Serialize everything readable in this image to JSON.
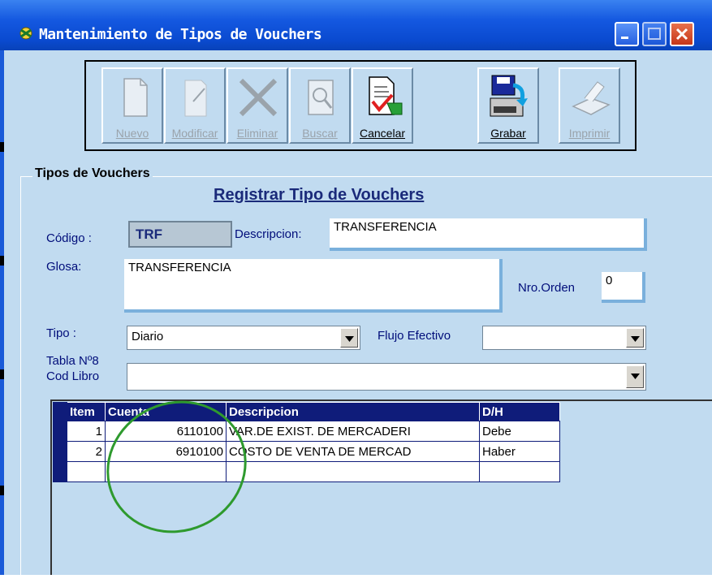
{
  "window": {
    "title": "Mantenimiento de Tipos de Vouchers"
  },
  "toolbar": {
    "buttons": [
      {
        "label": "Nuevo",
        "icon": "page-icon",
        "enabled": false
      },
      {
        "label": "Modificar",
        "icon": "edit-icon",
        "enabled": false
      },
      {
        "label": "Eliminar",
        "icon": "x-icon",
        "enabled": false
      },
      {
        "label": "Buscar",
        "icon": "search-doc-icon",
        "enabled": false
      },
      {
        "label": "Cancelar",
        "icon": "cancel-doc-icon",
        "enabled": true
      },
      {
        "label": "Grabar",
        "icon": "save-disk-icon",
        "enabled": true
      },
      {
        "label": "Imprimir",
        "icon": "printer-icon",
        "enabled": false
      }
    ]
  },
  "group": {
    "legend": "Tipos de Vouchers",
    "heading": "Registrar Tipo de Vouchers"
  },
  "form": {
    "codigo_label": "Código :",
    "codigo_value": "TRF",
    "descripcion_label": "Descripcion:",
    "descripcion_value": "TRANSFERENCIA",
    "glosa_label": "Glosa:",
    "glosa_value": "TRANSFERENCIA",
    "nro_orden_label": "Nro.Orden",
    "nro_orden_value": "0",
    "tipo_label": "Tipo :",
    "tipo_value": "Diario",
    "flujo_label": "Flujo Efectivo",
    "flujo_value": "",
    "tabla_label_1": "Tabla Nº8",
    "tabla_label_2": "Cod Libro",
    "tabla_value": ""
  },
  "grid": {
    "columns": [
      "Item",
      "Cuenta",
      "Descripcion",
      "D/H"
    ],
    "rows": [
      {
        "item": "1",
        "cuenta": "6110100",
        "descripcion": "VAR.DE EXIST. DE MERCADERI",
        "dh": "Debe"
      },
      {
        "item": "2",
        "cuenta": "6910100",
        "descripcion": "COSTO DE VENTA DE MERCAD",
        "dh": "Haber"
      },
      {
        "item": "",
        "cuenta": "",
        "descripcion": "",
        "dh": ""
      }
    ]
  },
  "colors": {
    "titlebar": "#0a4ad0",
    "client": "#c1dbf0",
    "grid_header": "#0f1c7a",
    "annotation_circle": "#2e9a2e"
  }
}
